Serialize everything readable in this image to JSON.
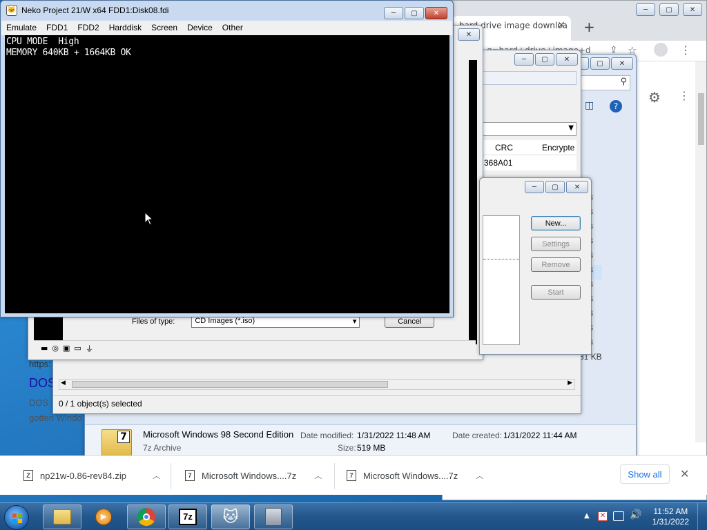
{
  "chrome": {
    "tab_title": "hard drive image downloa",
    "tab_close": "✕",
    "new_tab": "+",
    "url_fragment": "q=hard+drive+image+d",
    "window_controls": [
      "─",
      "▢",
      "✕"
    ]
  },
  "background_page": {
    "link_fragment": "https:",
    "heading_fragment": "DOS",
    "text_line1": "DOS",
    "text_line2": "gotten Windo"
  },
  "explorer": {
    "kb_values": [
      "KB",
      "KB",
      "KB",
      "KB",
      "KB",
      "KB",
      "KB",
      "KB",
      "KB",
      "KB",
      "KB",
      "81 KB"
    ],
    "file_name": "Microsoft Windows 98 Second Edition",
    "file_type": "7z Archive",
    "date_modified_label": "Date modified:",
    "date_modified": "1/31/2022 11:48 AM",
    "date_created_label": "Date created:",
    "date_created": "1/31/2022 11:44 AM",
    "size_label": "Size:",
    "size": "519 MB",
    "selection_status": "0 / 1 object(s) selected"
  },
  "sevenzip": {
    "columns": [
      "CRC",
      "Encrypte"
    ],
    "crc_value": "368A01"
  },
  "open_dialog": {
    "files_of_type_label": "Files of type:",
    "files_of_type_value": "CD Images (*.iso)",
    "cancel_label": "Cancel"
  },
  "hdd_dialog": {
    "buttons": [
      "New...",
      "Settings",
      "Remove",
      "Start"
    ]
  },
  "neko": {
    "title": "Neko Project 21/W x64  FDD1:Disk08.fdi",
    "menu": [
      "Emulate",
      "FDD1",
      "FDD2",
      "Harddisk",
      "Screen",
      "Device",
      "Other"
    ],
    "screen_lines": [
      "CPU MODE  High",
      "MEMORY 640KB + 1664KB OK"
    ]
  },
  "downloads": {
    "items": [
      "np21w-0.86-rev84.zip",
      "Microsoft Windows....7z",
      "Microsoft Windows....7z"
    ],
    "show_all": "Show all",
    "close": "✕"
  },
  "taskbar": {
    "time": "11:52 AM",
    "date": "1/31/2022",
    "tray_chevron": "▲"
  }
}
